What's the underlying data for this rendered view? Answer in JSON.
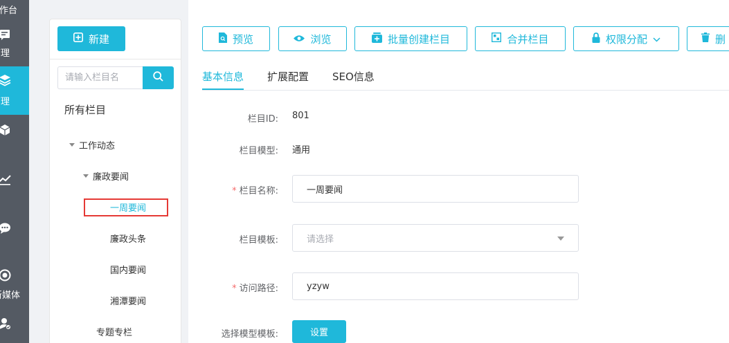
{
  "rail": {
    "items": [
      {
        "label": "工作台",
        "icon": "dashboard-icon",
        "active": false
      },
      {
        "label": "内容管理",
        "icon": "document-icon",
        "active": false
      },
      {
        "label": "栏目管理",
        "icon": "layers-icon",
        "active": true
      },
      {
        "label": "配置",
        "icon": "cube-icon",
        "active": false
      },
      {
        "label": "统计",
        "icon": "chart-icon",
        "active": false
      },
      {
        "label": "互动",
        "icon": "chat-icon",
        "active": false
      },
      {
        "label": "新媒体",
        "icon": "target-icon",
        "active": false
      },
      {
        "label": "会员",
        "icon": "user-icon",
        "active": false
      }
    ]
  },
  "sidebar": {
    "new_label": "新建",
    "search_placeholder": "请输入栏目名",
    "root_label": "所有栏目",
    "tree": [
      {
        "label": "工作动态",
        "level": 1,
        "expanded": true
      },
      {
        "label": "廉政要闻",
        "level": 2,
        "expanded": true
      },
      {
        "label": "一周要闻",
        "level": 3,
        "selected": true
      },
      {
        "label": "廉政头条",
        "level": 3
      },
      {
        "label": "国内要闻",
        "level": 3
      },
      {
        "label": "湘潭要闻",
        "level": 3
      },
      {
        "label": "专题专栏",
        "level": 2
      }
    ]
  },
  "toolbar": {
    "preview": "预览",
    "browse": "浏览",
    "batch_create": "批量创建栏目",
    "merge": "合并栏目",
    "permission": "权限分配",
    "delete": "删"
  },
  "tabs": [
    "基本信息",
    "扩展配置",
    "SEO信息"
  ],
  "form": {
    "id_label": "栏目ID:",
    "id_value": "801",
    "model_label": "栏目模型:",
    "model_value": "通用",
    "name_label": "栏目名称:",
    "name_value": "一周要闻",
    "template_label": "栏目模板:",
    "template_placeholder": "请选择",
    "path_label": "访问路径:",
    "path_value": "yzyw",
    "model_template_label": "选择模型模板:",
    "set_button": "设置"
  },
  "colors": {
    "accent": "#1fb8da",
    "rail_bg": "#545a63",
    "required": "#f56c6c",
    "highlight_box": "#e53935"
  }
}
